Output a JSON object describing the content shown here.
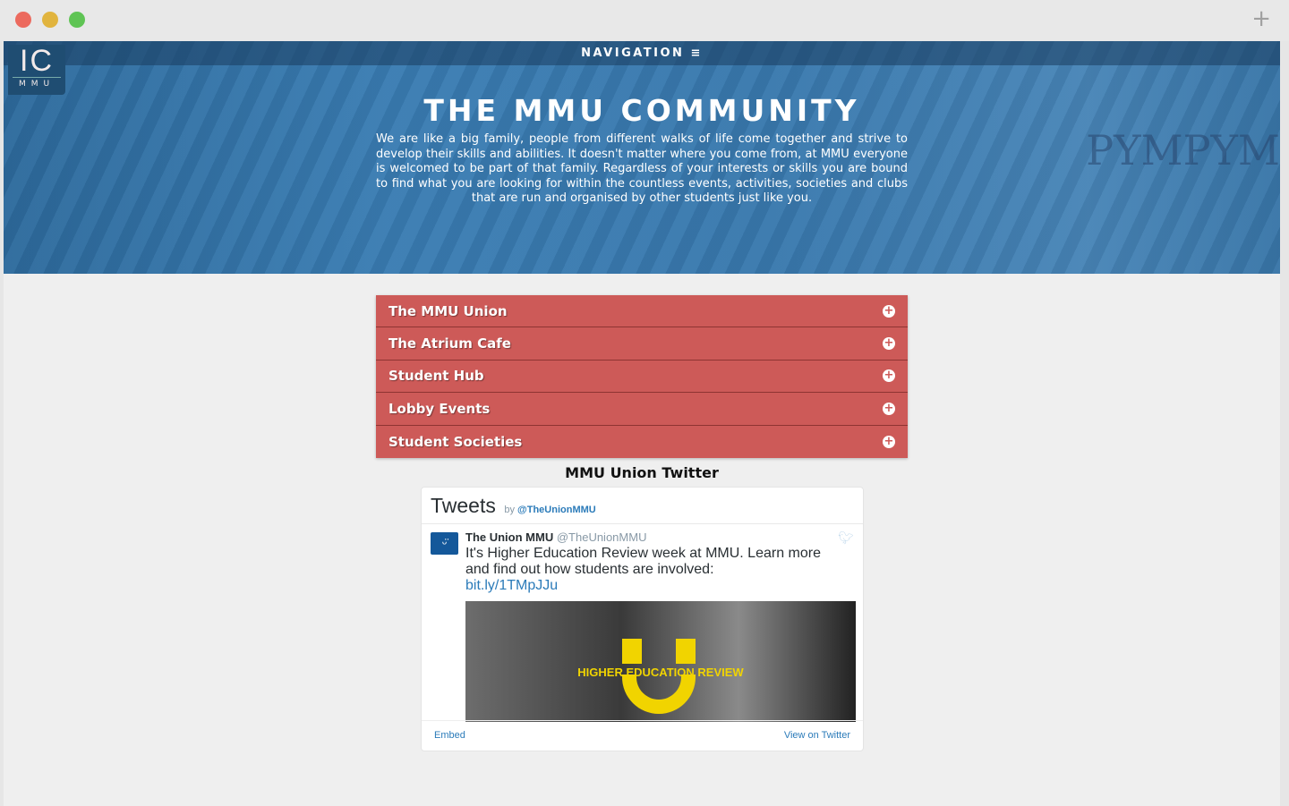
{
  "window": {
    "new_tab": "+"
  },
  "nav": {
    "label": "NAVIGATION ≡",
    "logo_main": "IC",
    "logo_sub": "MMU"
  },
  "hero": {
    "title": "THE MMU COMMUNITY",
    "text": "We are like a big family, people from different walks of life come together and strive to develop their skills and abilities. It doesn't matter where you come from, at MMU everyone is welcomed to be part of that family. Regardless of your interests or skills you are bound to find what you are looking for within the countless events, activities, societies and clubs that are run and organised by other students just like you."
  },
  "accordion": [
    {
      "label": "The MMU Union"
    },
    {
      "label": "The Atrium Cafe"
    },
    {
      "label": "Student Hub"
    },
    {
      "label": "Lobby Events"
    },
    {
      "label": "Student Societies"
    }
  ],
  "twitter": {
    "section_title": "MMU Union Twitter",
    "header": "Tweets",
    "by": "by",
    "by_handle": "@TheUnionMMU",
    "tweet": {
      "name": "The Union MMU",
      "handle": "@TheUnionMMU",
      "text": "It's Higher Education Review week at MMU. Learn more and find out how students are involved:",
      "link": "bit.ly/1TMpJJu",
      "image_caption": "HIGHER EDUCATION REVIEW"
    },
    "embed": "Embed",
    "view": "View on Twitter"
  },
  "colors": {
    "accordion": "#cd5a58",
    "hero": "#3a79ae",
    "link": "#2b7bb9"
  }
}
